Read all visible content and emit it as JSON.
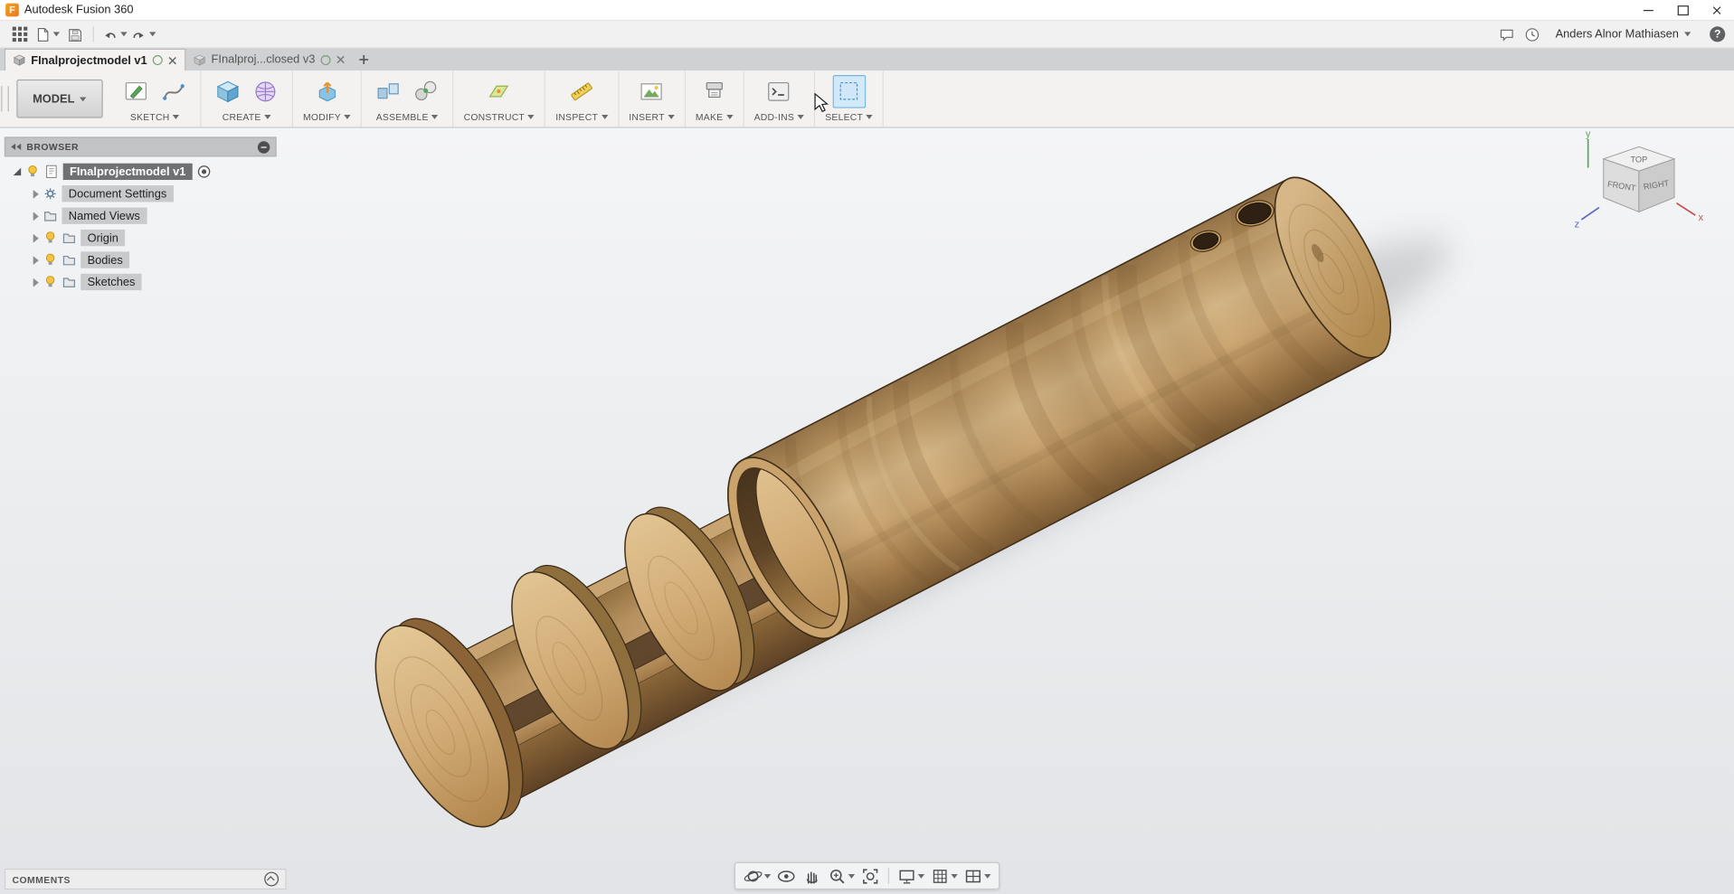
{
  "window": {
    "title": "Autodesk Fusion 360",
    "logo_text": "F"
  },
  "quickbar": {
    "user": "Anders Alnor Mathiasen",
    "help_glyph": "?"
  },
  "tabs": {
    "items": [
      {
        "label": "FInalprojectmodel v1"
      },
      {
        "label": "FInalproj...closed v3"
      }
    ]
  },
  "ribbon": {
    "workspace": "MODEL",
    "groups": [
      {
        "label": "SKETCH"
      },
      {
        "label": "CREATE"
      },
      {
        "label": "MODIFY"
      },
      {
        "label": "ASSEMBLE"
      },
      {
        "label": "CONSTRUCT"
      },
      {
        "label": "INSPECT"
      },
      {
        "label": "INSERT"
      },
      {
        "label": "MAKE"
      },
      {
        "label": "ADD-INS"
      },
      {
        "label": "SELECT"
      }
    ]
  },
  "browser": {
    "header": "BROWSER",
    "root_label": "FInalprojectmodel v1",
    "items": [
      {
        "label": "Document Settings"
      },
      {
        "label": "Named Views"
      },
      {
        "label": "Origin"
      },
      {
        "label": "Bodies"
      },
      {
        "label": "Sketches"
      }
    ]
  },
  "viewcube": {
    "top": "TOP",
    "front": "FRONT",
    "right": "RIGHT",
    "x": "x",
    "y": "y",
    "z": "z"
  },
  "comments": {
    "label": "COMMENTS"
  },
  "colors": {
    "accent_blue": "#3f96d2",
    "wood_light": "#d7b887",
    "wood_mid": "#c09a66",
    "wood_dark": "#7b5a34",
    "canvas_top": "#f4f5f6",
    "canvas_bottom": "#e2e4e7",
    "shadow": "#5f5f66"
  }
}
